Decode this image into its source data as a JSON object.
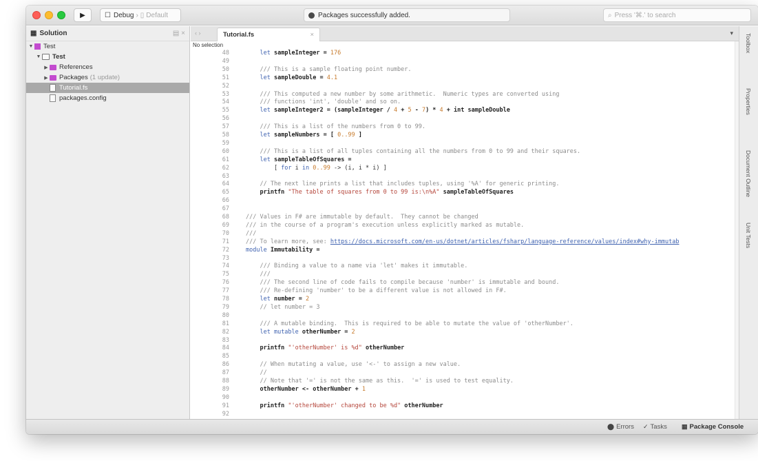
{
  "toolbar": {
    "config_label": "Debug",
    "target_label": "Default",
    "status_text": "Packages successfully added.",
    "search_placeholder": "Press '⌘.' to search"
  },
  "sidebar": {
    "header": "Solution",
    "items": [
      {
        "label": "Test",
        "type": "solution",
        "depth": 0,
        "arrow": "▼"
      },
      {
        "label": "Test",
        "type": "project",
        "depth": 1,
        "arrow": "▼",
        "bold": true
      },
      {
        "label": "References",
        "type": "folder",
        "depth": 2,
        "arrow": "▶"
      },
      {
        "label": "Packages",
        "note": "(1 update)",
        "type": "folder",
        "depth": 2,
        "arrow": "▶"
      },
      {
        "label": "Tutorial.fs",
        "type": "file",
        "depth": 2,
        "selected": true
      },
      {
        "label": "packages.config",
        "type": "file",
        "depth": 2
      }
    ]
  },
  "editor": {
    "tab_label": "Tutorial.fs",
    "breadcrumb": "No selection",
    "lines": [
      {
        "n": "48",
        "segs": [
          {
            "t": "    "
          },
          {
            "t": "let",
            "c": "kw"
          },
          {
            "t": " sampleInteger = ",
            "c": "bold"
          },
          {
            "t": "176",
            "c": "num"
          }
        ]
      },
      {
        "n": "49",
        "segs": []
      },
      {
        "n": "50",
        "segs": [
          {
            "t": "    /// This is a sample floating point number.",
            "c": "comment"
          }
        ]
      },
      {
        "n": "51",
        "segs": [
          {
            "t": "    "
          },
          {
            "t": "let",
            "c": "kw"
          },
          {
            "t": " sampleDouble = ",
            "c": "bold"
          },
          {
            "t": "4.1",
            "c": "num"
          }
        ]
      },
      {
        "n": "52",
        "segs": []
      },
      {
        "n": "53",
        "segs": [
          {
            "t": "    /// This computed a new number by some arithmetic.  Numeric types are converted using",
            "c": "comment"
          }
        ]
      },
      {
        "n": "54",
        "segs": [
          {
            "t": "    /// functions 'int', 'double' and so on.",
            "c": "comment"
          }
        ]
      },
      {
        "n": "55",
        "segs": [
          {
            "t": "    "
          },
          {
            "t": "let",
            "c": "kw"
          },
          {
            "t": " sampleInteger2 = (sampleInteger / ",
            "c": "bold"
          },
          {
            "t": "4",
            "c": "num"
          },
          {
            "t": " + ",
            "c": "bold"
          },
          {
            "t": "5",
            "c": "num"
          },
          {
            "t": " - ",
            "c": "bold"
          },
          {
            "t": "7",
            "c": "num"
          },
          {
            "t": ") * ",
            "c": "bold"
          },
          {
            "t": "4",
            "c": "num"
          },
          {
            "t": " + int sampleDouble",
            "c": "bold"
          }
        ]
      },
      {
        "n": "56",
        "segs": []
      },
      {
        "n": "57",
        "segs": [
          {
            "t": "    /// This is a list of the numbers from 0 to 99.",
            "c": "comment"
          }
        ]
      },
      {
        "n": "58",
        "segs": [
          {
            "t": "    "
          },
          {
            "t": "let",
            "c": "kw"
          },
          {
            "t": " sampleNumbers = [ ",
            "c": "bold"
          },
          {
            "t": "0..99",
            "c": "num"
          },
          {
            "t": " ]",
            "c": "bold"
          }
        ]
      },
      {
        "n": "59",
        "segs": []
      },
      {
        "n": "60",
        "segs": [
          {
            "t": "    /// This is a list of all tuples containing all the numbers from 0 to 99 and their squares.",
            "c": "comment"
          }
        ]
      },
      {
        "n": "61",
        "segs": [
          {
            "t": "    "
          },
          {
            "t": "let",
            "c": "kw"
          },
          {
            "t": " sampleTableOfSquares =",
            "c": "bold"
          }
        ]
      },
      {
        "n": "62",
        "segs": [
          {
            "t": "        [ "
          },
          {
            "t": "for",
            "c": "kw"
          },
          {
            "t": " i "
          },
          {
            "t": "in",
            "c": "kw"
          },
          {
            "t": " "
          },
          {
            "t": "0..99",
            "c": "num"
          },
          {
            "t": " -> (i, i * i) ]"
          }
        ]
      },
      {
        "n": "63",
        "segs": []
      },
      {
        "n": "64",
        "segs": [
          {
            "t": "    // The next line prints a list that includes tuples, using '%A' for generic printing.",
            "c": "comment"
          }
        ]
      },
      {
        "n": "65",
        "segs": [
          {
            "t": "    printfn ",
            "c": "bold"
          },
          {
            "t": "\"The table of squares from 0 to 99 is:\\n%A\"",
            "c": "str"
          },
          {
            "t": " sampleTableOfSquares",
            "c": "bold"
          }
        ]
      },
      {
        "n": "66",
        "segs": []
      },
      {
        "n": "67",
        "segs": []
      },
      {
        "n": "68",
        "segs": [
          {
            "t": "/// Values in F# are immutable by default.  They cannot be changed",
            "c": "comment"
          }
        ]
      },
      {
        "n": "69",
        "segs": [
          {
            "t": "/// in the course of a program's execution unless explicitly marked as mutable.",
            "c": "comment"
          }
        ]
      },
      {
        "n": "70",
        "segs": [
          {
            "t": "///",
            "c": "comment"
          }
        ]
      },
      {
        "n": "71",
        "segs": [
          {
            "t": "/// To learn more, see: ",
            "c": "comment"
          },
          {
            "t": "https://docs.microsoft.com/en-us/dotnet/articles/fsharp/language-reference/values/index#why-immutab",
            "c": "link"
          }
        ]
      },
      {
        "n": "72",
        "segs": [
          {
            "t": "module",
            "c": "kw"
          },
          {
            "t": " Immutability =",
            "c": "bold"
          }
        ]
      },
      {
        "n": "73",
        "segs": []
      },
      {
        "n": "74",
        "segs": [
          {
            "t": "    /// Binding a value to a name via 'let' makes it immutable.",
            "c": "comment"
          }
        ]
      },
      {
        "n": "75",
        "segs": [
          {
            "t": "    ///",
            "c": "comment"
          }
        ]
      },
      {
        "n": "76",
        "segs": [
          {
            "t": "    /// The second line of code fails to compile because 'number' is immutable and bound.",
            "c": "comment"
          }
        ]
      },
      {
        "n": "77",
        "segs": [
          {
            "t": "    /// Re-defining 'number' to be a different value is not allowed in F#.",
            "c": "comment"
          }
        ]
      },
      {
        "n": "78",
        "segs": [
          {
            "t": "    "
          },
          {
            "t": "let",
            "c": "kw"
          },
          {
            "t": " number = ",
            "c": "bold"
          },
          {
            "t": "2",
            "c": "num"
          }
        ]
      },
      {
        "n": "79",
        "segs": [
          {
            "t": "    // let number = 3",
            "c": "comment"
          }
        ]
      },
      {
        "n": "80",
        "segs": []
      },
      {
        "n": "81",
        "segs": [
          {
            "t": "    /// A mutable binding.  This is required to be able to mutate the value of 'otherNumber'.",
            "c": "comment"
          }
        ]
      },
      {
        "n": "82",
        "segs": [
          {
            "t": "    "
          },
          {
            "t": "let mutable",
            "c": "kw"
          },
          {
            "t": " otherNumber = ",
            "c": "bold"
          },
          {
            "t": "2",
            "c": "num"
          }
        ]
      },
      {
        "n": "83",
        "segs": []
      },
      {
        "n": "84",
        "segs": [
          {
            "t": "    printfn ",
            "c": "bold"
          },
          {
            "t": "\"'otherNumber' is %d\"",
            "c": "str"
          },
          {
            "t": " otherNumber",
            "c": "bold"
          }
        ]
      },
      {
        "n": "85",
        "segs": []
      },
      {
        "n": "86",
        "segs": [
          {
            "t": "    // When mutating a value, use '<-' to assign a new value.",
            "c": "comment"
          }
        ]
      },
      {
        "n": "87",
        "segs": [
          {
            "t": "    //",
            "c": "comment"
          }
        ]
      },
      {
        "n": "88",
        "segs": [
          {
            "t": "    // Note that '=' is not the same as this.  '=' is used to test equality.",
            "c": "comment"
          }
        ]
      },
      {
        "n": "89",
        "segs": [
          {
            "t": "    otherNumber <- otherNumber + ",
            "c": "bold"
          },
          {
            "t": "1",
            "c": "num"
          }
        ]
      },
      {
        "n": "90",
        "segs": []
      },
      {
        "n": "91",
        "segs": [
          {
            "t": "    printfn ",
            "c": "bold"
          },
          {
            "t": "\"'otherNumber' changed to be %d\"",
            "c": "str"
          },
          {
            "t": " otherNumber",
            "c": "bold"
          }
        ]
      },
      {
        "n": "92",
        "segs": []
      }
    ]
  },
  "pads": [
    "Toolbox",
    "Properties",
    "Document Outline",
    "Unit Tests"
  ],
  "statusbar": {
    "errors": "Errors",
    "tasks": "Tasks",
    "package_console": "Package Console"
  }
}
